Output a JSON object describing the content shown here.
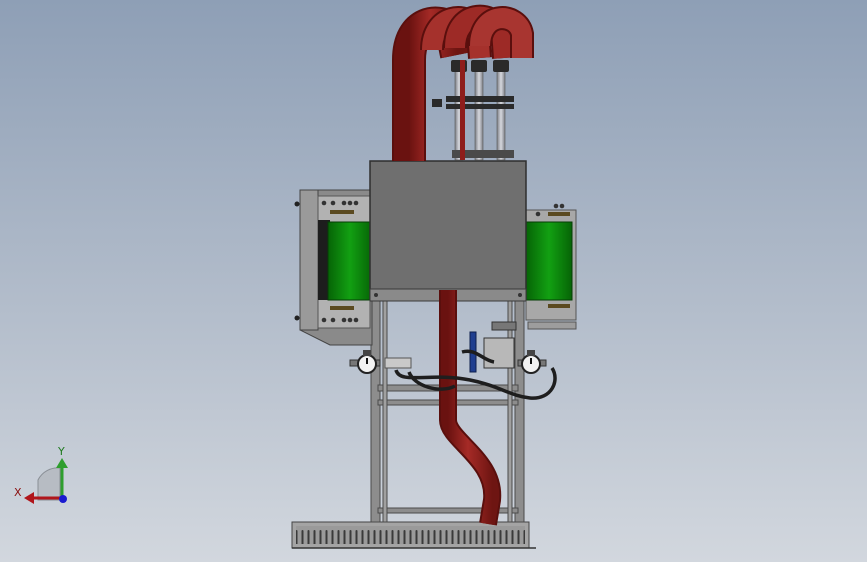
{
  "triad": {
    "x_label": "X",
    "y_label": "Y",
    "x_color": "#b0151b",
    "y_color": "#2e9e2e",
    "z_color": "#1a1ad0"
  },
  "colors": {
    "pipe": "#8e1d1b",
    "frame": "#8b8b8b",
    "box": "#6e6e6e",
    "belt": "#0b8a0b",
    "hose": "#222222"
  }
}
